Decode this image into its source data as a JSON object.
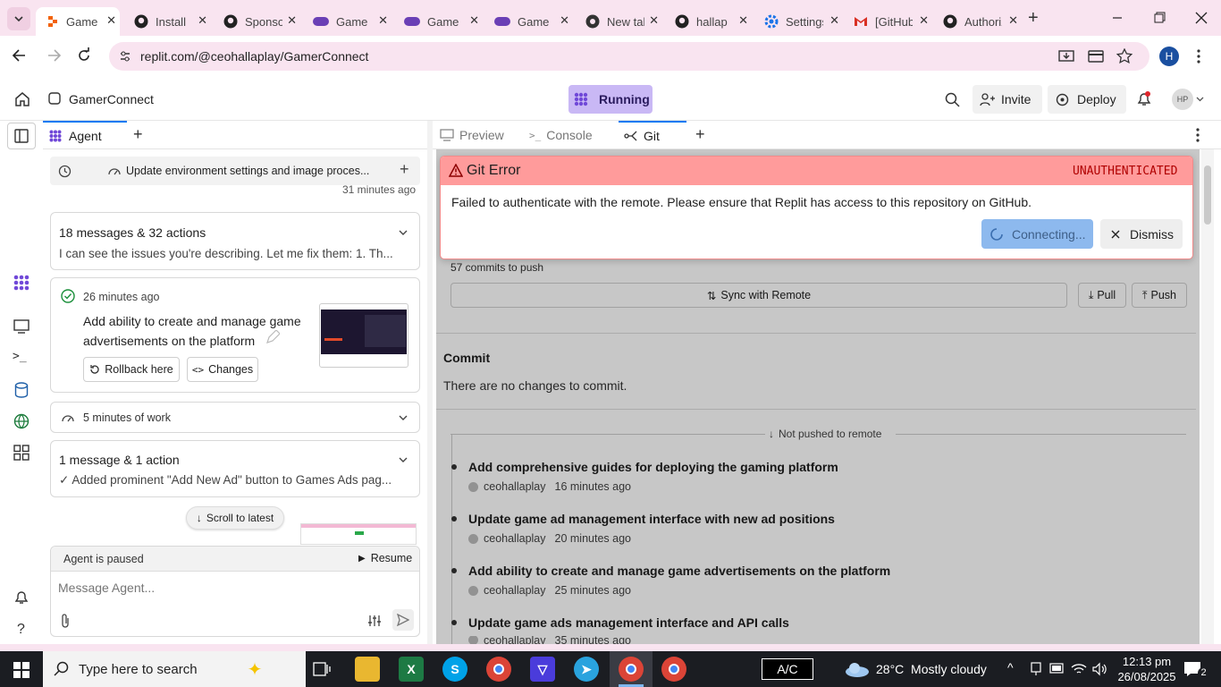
{
  "browser": {
    "tabs": [
      {
        "title": "Game",
        "icon": "replit-icon",
        "active": true
      },
      {
        "title": "Install",
        "icon": "github-icon"
      },
      {
        "title": "Sponsor",
        "icon": "github-icon"
      },
      {
        "title": "Game",
        "icon": "gamepad-icon"
      },
      {
        "title": "Game",
        "icon": "gamepad-icon"
      },
      {
        "title": "Game",
        "icon": "gamepad-icon"
      },
      {
        "title": "New tab",
        "icon": "chrome-icon"
      },
      {
        "title": "hallap",
        "icon": "github-icon"
      },
      {
        "title": "Settings",
        "icon": "gear-icon"
      },
      {
        "title": "[GitHub]",
        "icon": "gmail-icon"
      },
      {
        "title": "Authorize",
        "icon": "github-icon"
      }
    ],
    "url": "replit.com/@ceohallaplay/GamerConnect",
    "profile_initial": "H"
  },
  "header": {
    "project_name": "GamerConnect",
    "run_status": "Running",
    "invite_label": "Invite",
    "deploy_label": "Deploy",
    "avatar_initials": "HP"
  },
  "agent": {
    "tab_label": "Agent",
    "thread_title": "Update environment settings and image proces...",
    "thread_time": "31 minutes ago",
    "summary1_title": "18 messages & 32 actions",
    "summary1_text": "I can see the issues you're describing. Let me fix them: 1. Th...",
    "checkpoint_time": "26 minutes ago",
    "checkpoint_title": "Add ability to create and manage game advertisements on the platform",
    "rollback_label": "Rollback here",
    "changes_label": "Changes",
    "work_label": "5 minutes of work",
    "summary2_title": "1 message & 1 action",
    "summary2_text": "✓ Added prominent \"Add New Ad\" button to Games Ads pag...",
    "scroll_label": "Scroll to latest",
    "paused_label": "Agent is paused",
    "resume_label": "Resume",
    "input_placeholder": "Message Agent..."
  },
  "panel_tabs": {
    "preview": "Preview",
    "console": "Console",
    "git": "Git"
  },
  "git": {
    "error_title": "Git Error",
    "error_code": "UNAUTHENTICATED",
    "error_message": "Failed to authenticate with the remote. Please ensure that Replit has access to this repository on GitHub.",
    "connecting_label": "Connecting...",
    "dismiss_label": "Dismiss",
    "commits_to_push": "57 commits to push",
    "sync_label": "Sync with Remote",
    "pull_label": "Pull",
    "push_label": "Push",
    "commit_heading": "Commit",
    "no_changes": "There are no changes to commit.",
    "not_pushed": "Not pushed to remote",
    "commits": [
      {
        "title": "Add comprehensive guides for deploying the gaming platform",
        "author": "ceohallaplay",
        "time": "16 minutes ago"
      },
      {
        "title": "Update game ad management interface with new ad positions",
        "author": "ceohallaplay",
        "time": "20 minutes ago"
      },
      {
        "title": "Add ability to create and manage game advertisements on the platform",
        "author": "ceohallaplay",
        "time": "25 minutes ago"
      },
      {
        "title": "Update game ads management interface and API calls",
        "author": "ceohallaplay",
        "time": "35 minutes ago"
      }
    ]
  },
  "taskbar": {
    "search_placeholder": "Type here to search",
    "ac_label": "A/C",
    "weather": "28°C  Mostly cloudy",
    "time": "12:13 pm",
    "date": "26/08/2025",
    "notif_count": "2"
  },
  "colors": {
    "accent": "#0079f2",
    "error_bg": "#ff9b9b",
    "running": "#c9b8f5"
  }
}
